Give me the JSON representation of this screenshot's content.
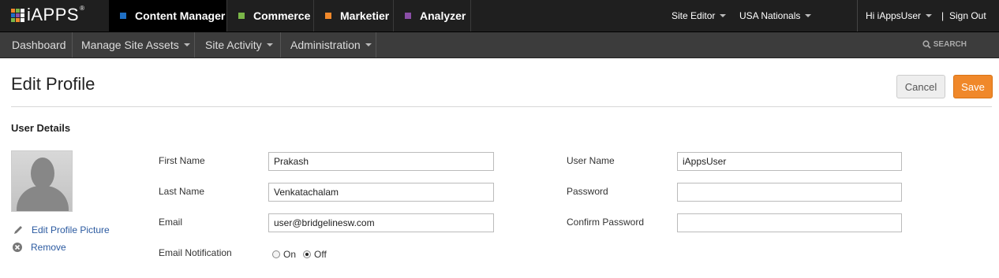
{
  "brand": {
    "name": "iAPPS",
    "mark": "®"
  },
  "apps": [
    {
      "label": "Content Manager",
      "color": "#1f6fc4",
      "active": true
    },
    {
      "label": "Commerce",
      "color": "#7ab648"
    },
    {
      "label": "Marketier",
      "color": "#f0882a"
    },
    {
      "label": "Analyzer",
      "color": "#8a4ea6"
    }
  ],
  "top_right": {
    "site_editor": "Site Editor",
    "site": "USA Nationals",
    "greeting": "Hi iAppsUser",
    "separator": "|",
    "sign_out": "Sign Out"
  },
  "subnav": {
    "items": [
      "Dashboard",
      "Manage Site Assets",
      "Site Activity",
      "Administration"
    ],
    "search_label": "SEARCH"
  },
  "page": {
    "title": "Edit Profile",
    "cancel": "Cancel",
    "save": "Save",
    "section": "User Details"
  },
  "profile_picture": {
    "edit": "Edit Profile Picture",
    "remove": "Remove"
  },
  "form": {
    "first_name": {
      "label": "First Name",
      "value": "Prakash"
    },
    "last_name": {
      "label": "Last Name",
      "value": "Venkatachalam"
    },
    "email": {
      "label": "Email",
      "value": "user@bridgelinesw.com"
    },
    "email_notification": {
      "label": "Email Notification",
      "on": "On",
      "off": "Off",
      "selected": "Off"
    },
    "user_name": {
      "label": "User Name",
      "value": "iAppsUser"
    },
    "password": {
      "label": "Password",
      "value": ""
    },
    "confirm_password": {
      "label": "Confirm Password",
      "value": ""
    }
  }
}
